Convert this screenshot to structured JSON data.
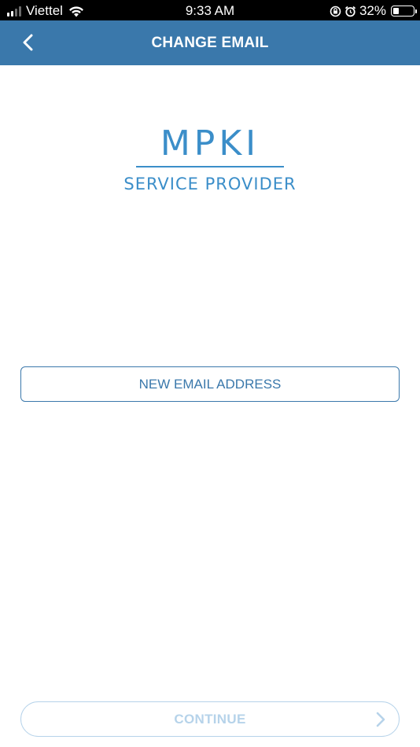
{
  "status_bar": {
    "carrier": "Viettel",
    "time": "9:33 AM",
    "battery_percent": "32%",
    "battery_level": 0.32,
    "signal_bars_active": 2,
    "icons": [
      "signal-icon",
      "wifi-icon",
      "orientation-lock-icon",
      "alarm-icon",
      "battery-icon"
    ]
  },
  "nav": {
    "title": "CHANGE EMAIL",
    "back_icon": "chevron-left-icon"
  },
  "logo": {
    "main": "MPKI",
    "sub": "SERVICE PROVIDER"
  },
  "form": {
    "email_placeholder": "NEW EMAIL ADDRESS",
    "email_value": ""
  },
  "actions": {
    "continue_label": "CONTINUE",
    "continue_icon": "chevron-right-icon"
  },
  "colors": {
    "nav_background": "#3a78ab",
    "brand_blue": "#3b8ec9",
    "disabled_button": "#b6d3ea"
  }
}
